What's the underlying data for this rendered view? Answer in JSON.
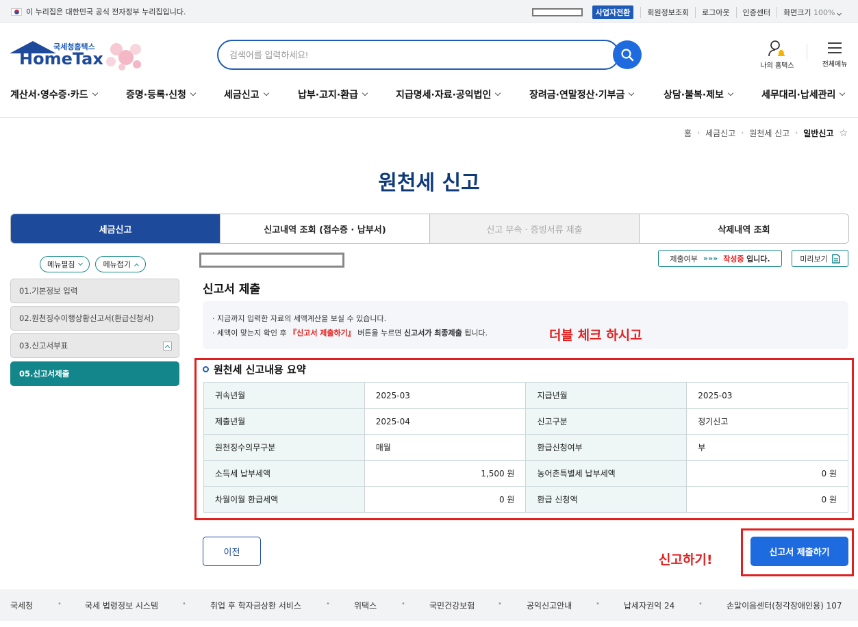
{
  "topbar": {
    "gov_notice": "이 누리집은 대한민국 공식 전자정부 누리집입니다.",
    "biz_switch": "사업자전환",
    "links": [
      "회원정보조회",
      "로그아웃",
      "인증센터"
    ],
    "zoom_label": "화면크기",
    "zoom_value": "100%"
  },
  "header": {
    "logo_small": "국세청홈택스",
    "logo_big": "HomeTax",
    "search_placeholder": "검색어를 입력하세요!",
    "my_hometax": "나의 홈택스",
    "all_menu": "전체메뉴"
  },
  "gnb": [
    "계산서·영수증·카드",
    "증명·등록·신청",
    "세금신고",
    "납부·고지·환급",
    "지급명세·자료·공익법인",
    "장려금·연말정산·기부금",
    "상담·불복·제보",
    "세무대리·납세관리"
  ],
  "breadcrumb": [
    "홈",
    "세금신고",
    "원천세 신고",
    "일반신고"
  ],
  "page_title": "원천세 신고",
  "tabs": [
    "세금신고",
    "신고내역 조회 (접수증 · 납부서)",
    "신고 부속 · 증빙서류 제출",
    "삭제내역 조회"
  ],
  "side": {
    "expand": "메뉴펼침",
    "collapse": "메뉴접기",
    "items": [
      "01.기본정보 입력",
      "02.원천징수이행상황신고서(환급신청서)",
      "03.신고서부표",
      "05.신고서제출"
    ]
  },
  "status": {
    "label": "제출여부",
    "arrows": "»»»",
    "state": "작성중",
    "suffix": "입니다."
  },
  "preview_label": "미리보기",
  "section_title": "신고서 제출",
  "notice": {
    "line1": "지금까지 입력한 자료의 세액계산을 보실 수 있습니다.",
    "line2_a": "세액이 맞는지 확인 후",
    "line2_red": "『신고서 제출하기』",
    "line2_b": "버튼을 누르면",
    "line2_bold": "신고서가 최종제출",
    "line2_c": "됩니다."
  },
  "annotation_top": "더블 체크 하시고",
  "annotation_bottom": "신고하기!",
  "summary": {
    "title": "원천세 신고내용 요약",
    "rows": [
      [
        "귀속년월",
        "2025-03",
        "지급년월",
        "2025-03"
      ],
      [
        "제출년월",
        "2025-04",
        "신고구분",
        "정기신고"
      ],
      [
        "원천징수의무구분",
        "매월",
        "환급신청여부",
        "부"
      ],
      [
        "소득세 납부세액",
        "1,500 원",
        "농어촌특별세 납부세액",
        "0 원"
      ],
      [
        "차월이월 환급세액",
        "0 원",
        "환급 신청액",
        "0 원"
      ]
    ]
  },
  "buttons": {
    "prev": "이전",
    "submit": "신고서 제출하기"
  },
  "footer": [
    "국세청",
    "국세 법령정보 시스템",
    "취업 후 학자금상환 서비스",
    "위택스",
    "국민건강보험",
    "공익신고안내",
    "납세자권익 24",
    "손말이음센터(청각장애인용) 107"
  ]
}
